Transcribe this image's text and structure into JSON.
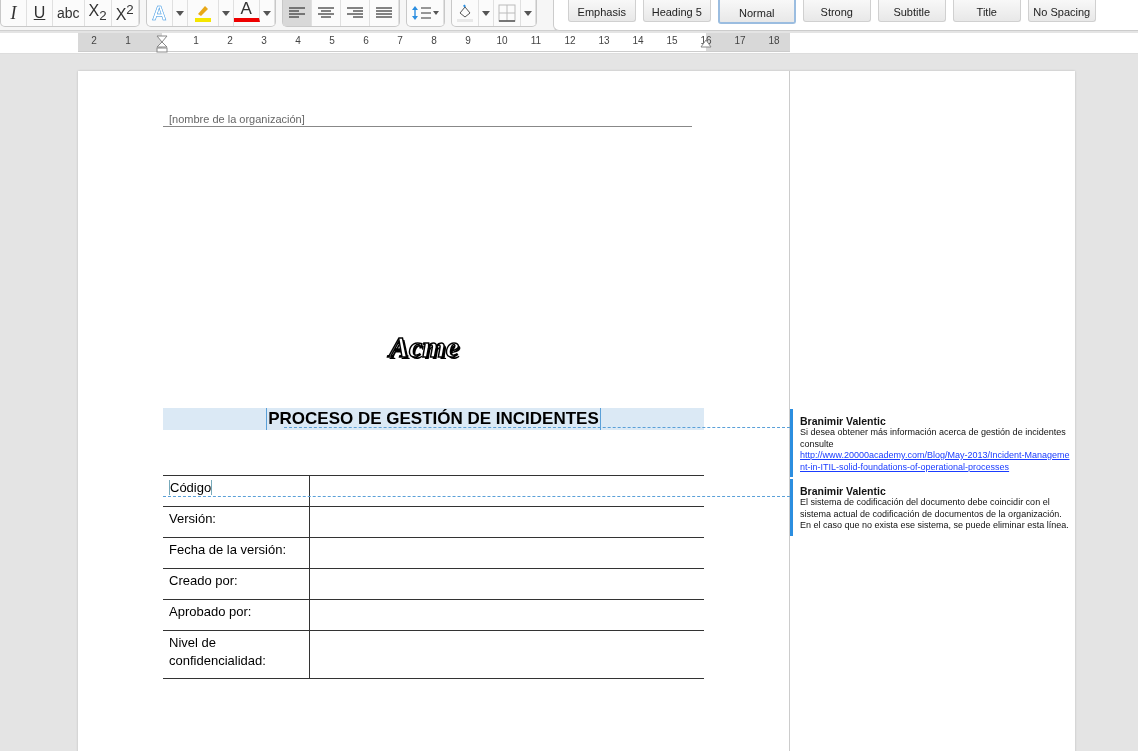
{
  "toolbar": {
    "format_buttons": [
      {
        "label": "I",
        "kind": "italic"
      },
      {
        "label": "U",
        "kind": "underline"
      },
      {
        "label": "abc",
        "kind": "strike"
      },
      {
        "label": "X$_{2}$",
        "kind": "plain"
      },
      {
        "label": "X$^{2}$",
        "kind": "plain"
      }
    ],
    "text_color_buttons": [
      {
        "label": "A",
        "kind": "effects"
      },
      {
        "kind": "highlight"
      },
      {
        "label": "A",
        "kind": "fontcolor"
      }
    ],
    "align_buttons": [
      {
        "kind": "left",
        "selected": true
      },
      {
        "kind": "center",
        "selected": false
      },
      {
        "kind": "right",
        "selected": false
      },
      {
        "kind": "justify",
        "selected": false
      }
    ],
    "styles": [
      {
        "label": "Emphasis",
        "selected": false
      },
      {
        "label": "Heading 5",
        "selected": false
      },
      {
        "label": "Normal",
        "selected": true
      },
      {
        "label": "Strong",
        "selected": false
      },
      {
        "label": "Subtitle",
        "selected": false
      },
      {
        "label": "Title",
        "selected": false
      },
      {
        "label": "No Spacing",
        "selected": false
      }
    ]
  },
  "ruler": {
    "left_labels": [
      "2",
      "1"
    ],
    "labels": [
      "1",
      "2",
      "3",
      "4",
      "5",
      "6",
      "7",
      "8",
      "9",
      "10",
      "11",
      "12",
      "13",
      "14",
      "15",
      "16",
      "17",
      "18"
    ]
  },
  "document": {
    "header": "[nombre de la organización]",
    "logo": "Acme",
    "title": "PROCESO DE GESTIÓN DE INCIDENTES",
    "table": [
      {
        "label": "Código"
      },
      {
        "label": "Versión:"
      },
      {
        "label": "Fecha de la versión:"
      },
      {
        "label": "Creado por:"
      },
      {
        "label": "Aprobado por:"
      },
      {
        "label": "Nivel de confidencialidad:"
      }
    ]
  },
  "comments": [
    {
      "author": "Branimir Valentic",
      "text": "Si desea obtener más información acerca de gestión de incidentes consulte",
      "link": "http://www.20000academy.com/Blog/May-2013/Incident-Management-in-ITIL-solid-foundations-of-operational-processes"
    },
    {
      "author": "Branimir Valentic",
      "text": "El sistema de codificación del documento debe coincidir con el sistema actual de codificación de documentos de la organización. En el caso que no exista ese sistema, se puede eliminar esta línea."
    }
  ]
}
